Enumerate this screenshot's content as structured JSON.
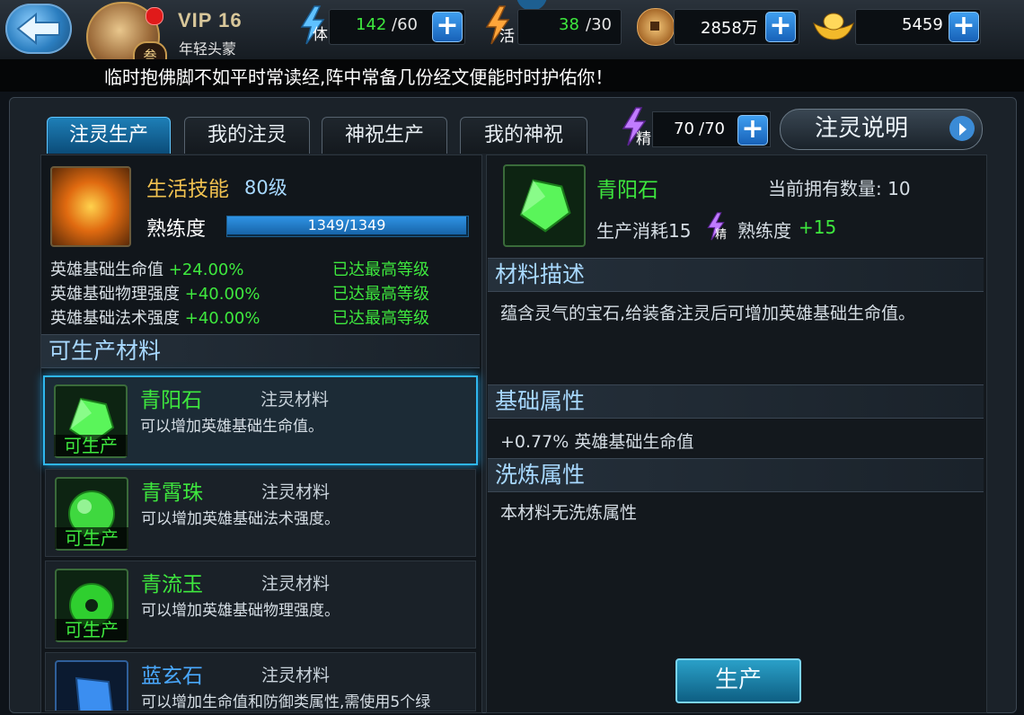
{
  "header": {
    "vip": "VIP 16",
    "player_name": "年轻头蒙",
    "avatar_badge": "叁",
    "stamina": {
      "icon_label": "体",
      "value": "142",
      "max": "/60"
    },
    "vitality": {
      "icon_label": "活",
      "value": "38",
      "max": "/30"
    },
    "copper": "2858万",
    "gold": "5459"
  },
  "marquee": "临时抱佛脚不如平时常读经,阵中常备几份经文便能时时护佑你！",
  "tabs": [
    {
      "label": "注灵生产",
      "active": true
    },
    {
      "label": "我的注灵",
      "active": false
    },
    {
      "label": "神祝生产",
      "active": false
    },
    {
      "label": "我的神祝",
      "active": false
    }
  ],
  "essence": {
    "icon_label": "精",
    "value": "70",
    "max": "/70"
  },
  "explain_button": "注灵说明",
  "skill": {
    "title": "生活技能",
    "level": "80级",
    "proficiency_label": "熟练度",
    "proficiency_text": "1349/1349",
    "proficiency_fraction": 1.0
  },
  "stats": [
    {
      "label": "英雄基础生命值",
      "bonus": "+24.00%",
      "status": "已达最高等级"
    },
    {
      "label": "英雄基础物理强度",
      "bonus": "+40.00%",
      "status": "已达最高等级"
    },
    {
      "label": "英雄基础法术强度",
      "bonus": "+40.00%",
      "status": "已达最高等级"
    }
  ],
  "materials_header": "可生产材料",
  "materials": [
    {
      "name": "青阳石",
      "type": "注灵材料",
      "desc": "可以增加英雄基础生命值。",
      "badge": "可生产",
      "selected": true,
      "color": "#3ee83e"
    },
    {
      "name": "青霄珠",
      "type": "注灵材料",
      "desc": "可以增加英雄基础法术强度。",
      "badge": "可生产",
      "selected": false,
      "color": "#3ee83e"
    },
    {
      "name": "青流玉",
      "type": "注灵材料",
      "desc": "可以增加英雄基础物理强度。",
      "badge": "可生产",
      "selected": false,
      "color": "#3ee83e"
    },
    {
      "name": "蓝玄石",
      "type": "注灵材料",
      "desc": "可以增加生命值和防御类属性,需使用5个绿",
      "badge": "",
      "selected": false,
      "color": "#4aa9ff"
    }
  ],
  "detail": {
    "name": "青阳石",
    "owned_label": "当前拥有数量: 10",
    "cost_label": "生产消耗15",
    "cost_icon_label": "精",
    "prof_label": "熟练度",
    "prof_gain": "+15",
    "desc_header": "材料描述",
    "desc": "蕴含灵气的宝石,给装备注灵后可增加英雄基础生命值。",
    "base_header": "基础属性",
    "base": "+0.77% 英雄基础生命值",
    "refine_header": "洗炼属性",
    "refine": "本材料无洗炼属性"
  },
  "produce_button": "生产"
}
